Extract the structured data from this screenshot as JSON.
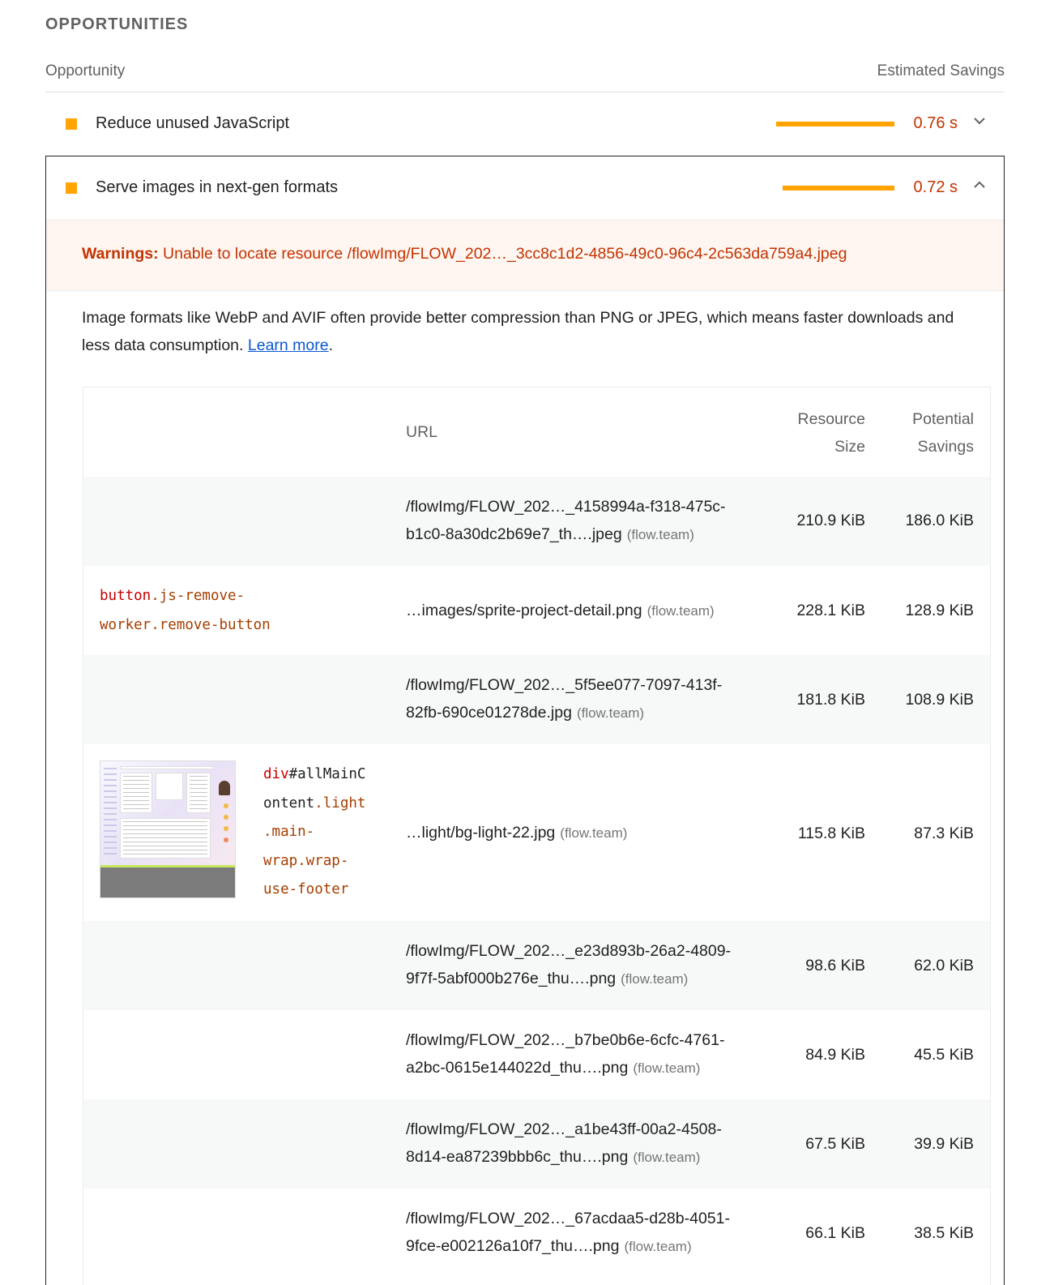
{
  "section": {
    "title": "OPPORTUNITIES",
    "col_opportunity": "Opportunity",
    "col_savings": "Estimated Savings"
  },
  "audits": [
    {
      "title": "Reduce unused JavaScript",
      "savings": "0.76 s",
      "bar_fraction": 0.94,
      "expanded": false
    },
    {
      "title": "Serve images in next-gen formats",
      "savings": "0.72 s",
      "bar_fraction": 0.89,
      "expanded": true
    }
  ],
  "colors": {
    "accent_average": "#ffa400",
    "savings_text": "#c33300",
    "link": "#0b57d0"
  },
  "details": {
    "warning_label": "Warnings:",
    "warning_text": "Unable to locate resource /flowImg/FLOW_202…_3cc8c1d2-4856-49c0-96c4-2c563da759a4.jpeg",
    "description": "Image formats like WebP and AVIF often provide better compression than PNG or JPEG, which means faster downloads and less data consumption.",
    "learn_more": "Learn more",
    "trailing": ".",
    "table": {
      "headers": {
        "url": "URL",
        "size_1": "Resource",
        "size_2": "Size",
        "savings_1": "Potential",
        "savings_2": "Savings"
      },
      "rows": [
        {
          "url_line1": "/flowImg/FLOW_202…_4158994a-f318-475c-",
          "url_line2": "b1c0-8a30dc2b69e7_th….jpeg",
          "host": "(flow.team)",
          "size": "210.9 KiB",
          "savings": "186.0 KiB"
        },
        {
          "node": {
            "tag": "button",
            "cls1": ".js-remove-",
            "cls2": "worker.remove-button"
          },
          "url_line1": "…images/sprite-project-detail.png",
          "host": "(flow.team)",
          "size": "228.1 KiB",
          "savings": "128.9 KiB"
        },
        {
          "url_line1": "/flowImg/FLOW_202…_5f5ee077-7097-413f-",
          "url_line2": "82fb-690ce01278de.jpg",
          "host": "(flow.team)",
          "size": "181.8 KiB",
          "savings": "108.9 KiB"
        },
        {
          "node": {
            "tag": "div",
            "id1": "#allMainC",
            "id2": "ontent",
            "c1": ".light",
            "c2": ".main-",
            "c3": "wrap.wrap-",
            "c4": "use-footer"
          },
          "url_line1": "…light/bg-light-22.jpg",
          "host": "(flow.team)",
          "size": "115.8 KiB",
          "savings": "87.3 KiB"
        },
        {
          "url_line1": "/flowImg/FLOW_202…_e23d893b-26a2-4809-",
          "url_line2": "9f7f-5abf000b276e_thu….png",
          "host": "(flow.team)",
          "size": "98.6 KiB",
          "savings": "62.0 KiB"
        },
        {
          "url_line1": "/flowImg/FLOW_202…_b7be0b6e-6cfc-4761-",
          "url_line2": "a2bc-0615e144022d_thu….png",
          "host": "(flow.team)",
          "size": "84.9 KiB",
          "savings": "45.5 KiB"
        },
        {
          "url_line1": "/flowImg/FLOW_202…_a1be43ff-00a2-4508-",
          "url_line2": "8d14-ea87239bbb6c_thu….png",
          "host": "(flow.team)",
          "size": "67.5 KiB",
          "savings": "39.9 KiB"
        },
        {
          "url_line1": "/flowImg/FLOW_202…_67acdaa5-d28b-4051-",
          "url_line2": "9fce-e002126a10f7_thu….png",
          "host": "(flow.team)",
          "size": "66.1 KiB",
          "savings": "38.5 KiB"
        }
      ]
    }
  }
}
